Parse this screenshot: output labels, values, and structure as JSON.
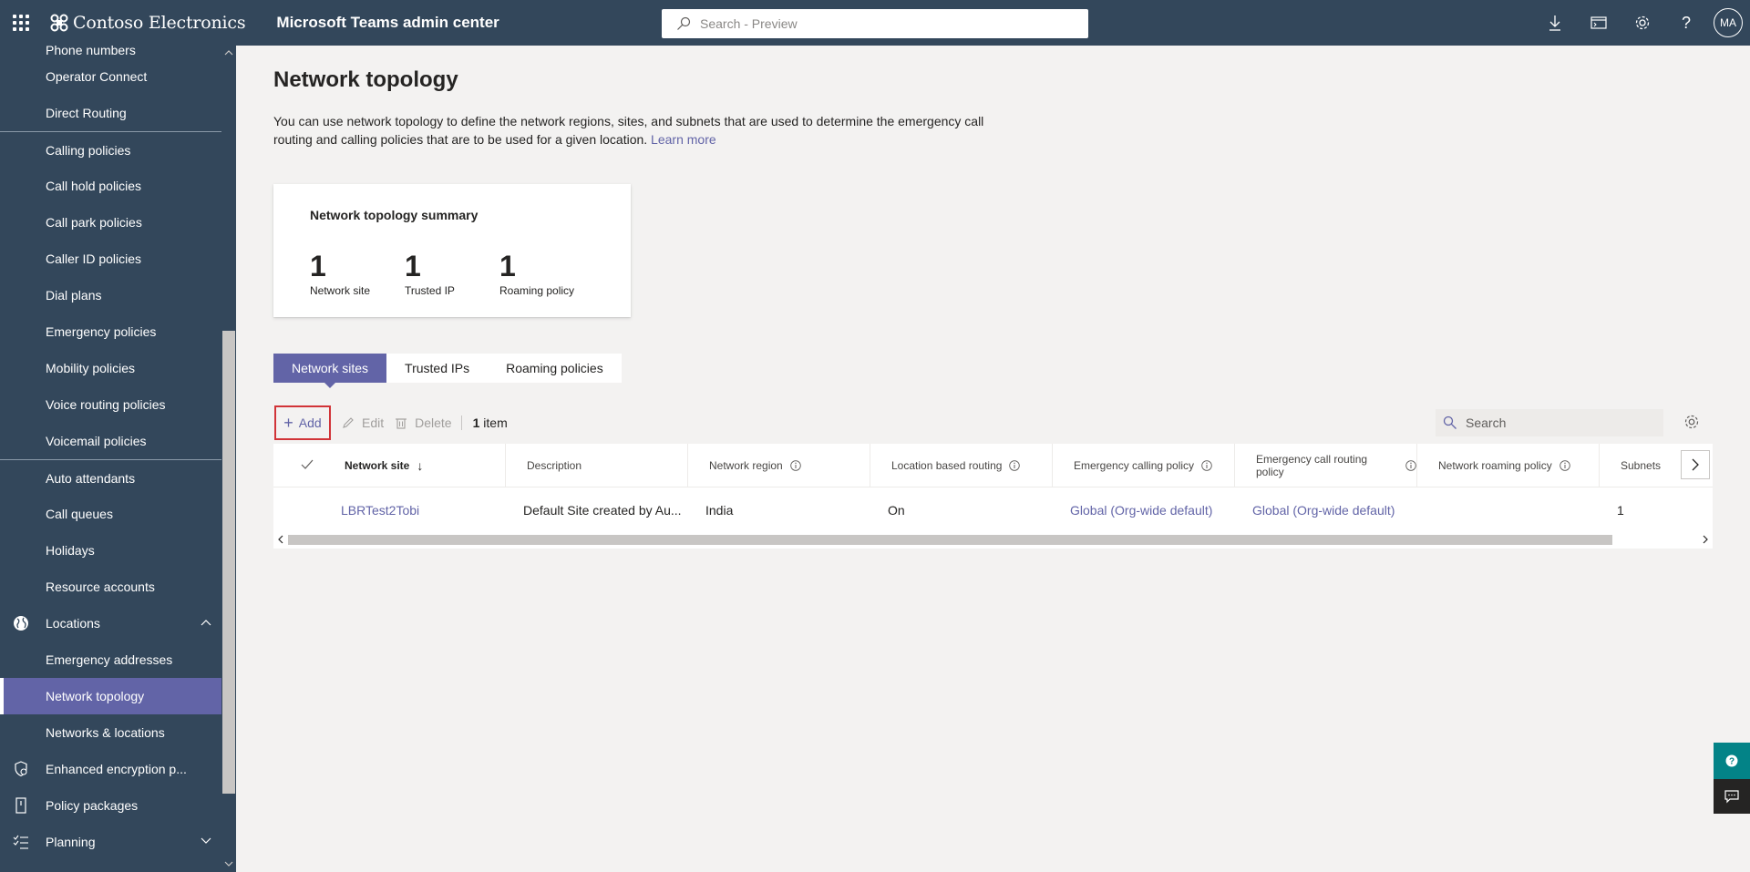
{
  "header": {
    "brand": "Contoso Electronics",
    "app_title": "Microsoft Teams admin center",
    "search_placeholder": "Search - Preview",
    "avatar_initials": "MA",
    "icons": [
      "download-icon",
      "terminal-icon",
      "gear-icon",
      "help-icon"
    ]
  },
  "sidebar": {
    "items": [
      {
        "label": "Phone numbers"
      },
      {
        "label": "Operator Connect"
      },
      {
        "label": "Direct Routing"
      },
      {
        "label": "Calling policies"
      },
      {
        "label": "Call hold policies"
      },
      {
        "label": "Call park policies"
      },
      {
        "label": "Caller ID policies"
      },
      {
        "label": "Dial plans"
      },
      {
        "label": "Emergency policies"
      },
      {
        "label": "Mobility policies"
      },
      {
        "label": "Voice routing policies"
      },
      {
        "label": "Voicemail policies"
      },
      {
        "label": "Auto attendants"
      },
      {
        "label": "Call queues"
      },
      {
        "label": "Holidays"
      },
      {
        "label": "Resource accounts"
      },
      {
        "label": "Locations",
        "icon": "globe-icon",
        "expanded": true
      },
      {
        "label": "Emergency addresses"
      },
      {
        "label": "Network topology",
        "active": true
      },
      {
        "label": "Networks & locations"
      },
      {
        "label": "Enhanced encryption p...",
        "icon": "shield-icon"
      },
      {
        "label": "Policy packages",
        "icon": "package-icon"
      },
      {
        "label": "Planning",
        "icon": "checklist-icon",
        "expanded": false
      }
    ]
  },
  "main": {
    "title": "Network topology",
    "description": "You can use network topology to define the network regions, sites, and subnets that are used to determine the emergency call routing and calling policies that are to be used for a given location.",
    "learn_more": "Learn more",
    "summary": {
      "title": "Network topology summary",
      "stats": [
        {
          "value": "1",
          "label": "Network site"
        },
        {
          "value": "1",
          "label": "Trusted IP"
        },
        {
          "value": "1",
          "label": "Roaming policy"
        }
      ]
    },
    "tabs": [
      {
        "label": "Network sites",
        "active": true
      },
      {
        "label": "Trusted IPs"
      },
      {
        "label": "Roaming policies"
      }
    ],
    "toolbar": {
      "add": "Add",
      "edit": "Edit",
      "delete": "Delete",
      "count_num": "1",
      "count_label": "item",
      "search_placeholder": "Search"
    },
    "table": {
      "columns": [
        "Network site",
        "Description",
        "Network region",
        "Location based routing",
        "Emergency calling policy",
        "Emergency call routing policy",
        "Network roaming policy",
        "Subnets"
      ],
      "rows": [
        {
          "network_site": "LBRTest2Tobi",
          "description": "Default Site created by Au...",
          "network_region": "India",
          "location_based_routing": "On",
          "emergency_calling_policy": "Global (Org-wide default)",
          "emergency_call_routing_policy": "Global (Org-wide default)",
          "network_roaming_policy": "",
          "subnets": "1"
        }
      ]
    }
  },
  "colors": {
    "header_bg": "#33475b",
    "accent": "#6264a7",
    "highlight_border": "#d13438",
    "help_teal": "#038387"
  }
}
